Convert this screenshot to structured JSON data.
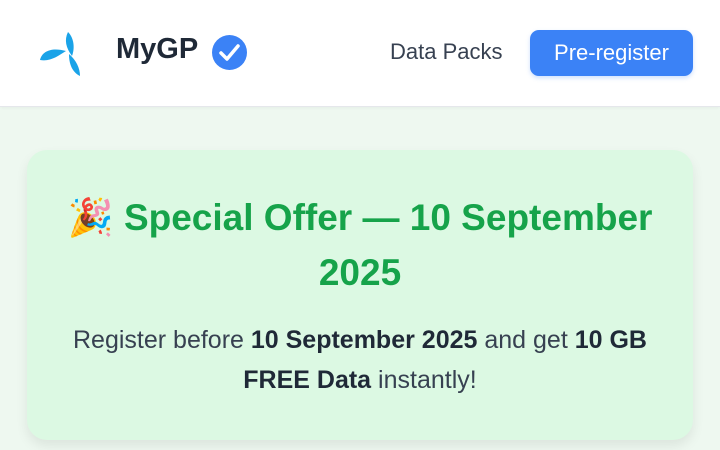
{
  "header": {
    "brand_name": "MyGP",
    "nav_link": "Data Packs",
    "cta_label": "Pre-register",
    "logo_icon": "grameenphone-logo-icon",
    "verified_icon": "verified-check-icon",
    "accent_color": "#3b82f6"
  },
  "offer": {
    "emoji": "🎉",
    "title": "Special Offer — 10 September 2025",
    "text_1": "Register before ",
    "text_date": "10 September 2025",
    "text_2": " and get ",
    "text_bonus": "10 GB FREE Data",
    "text_3": " instantly!",
    "title_color": "#16a34a"
  }
}
